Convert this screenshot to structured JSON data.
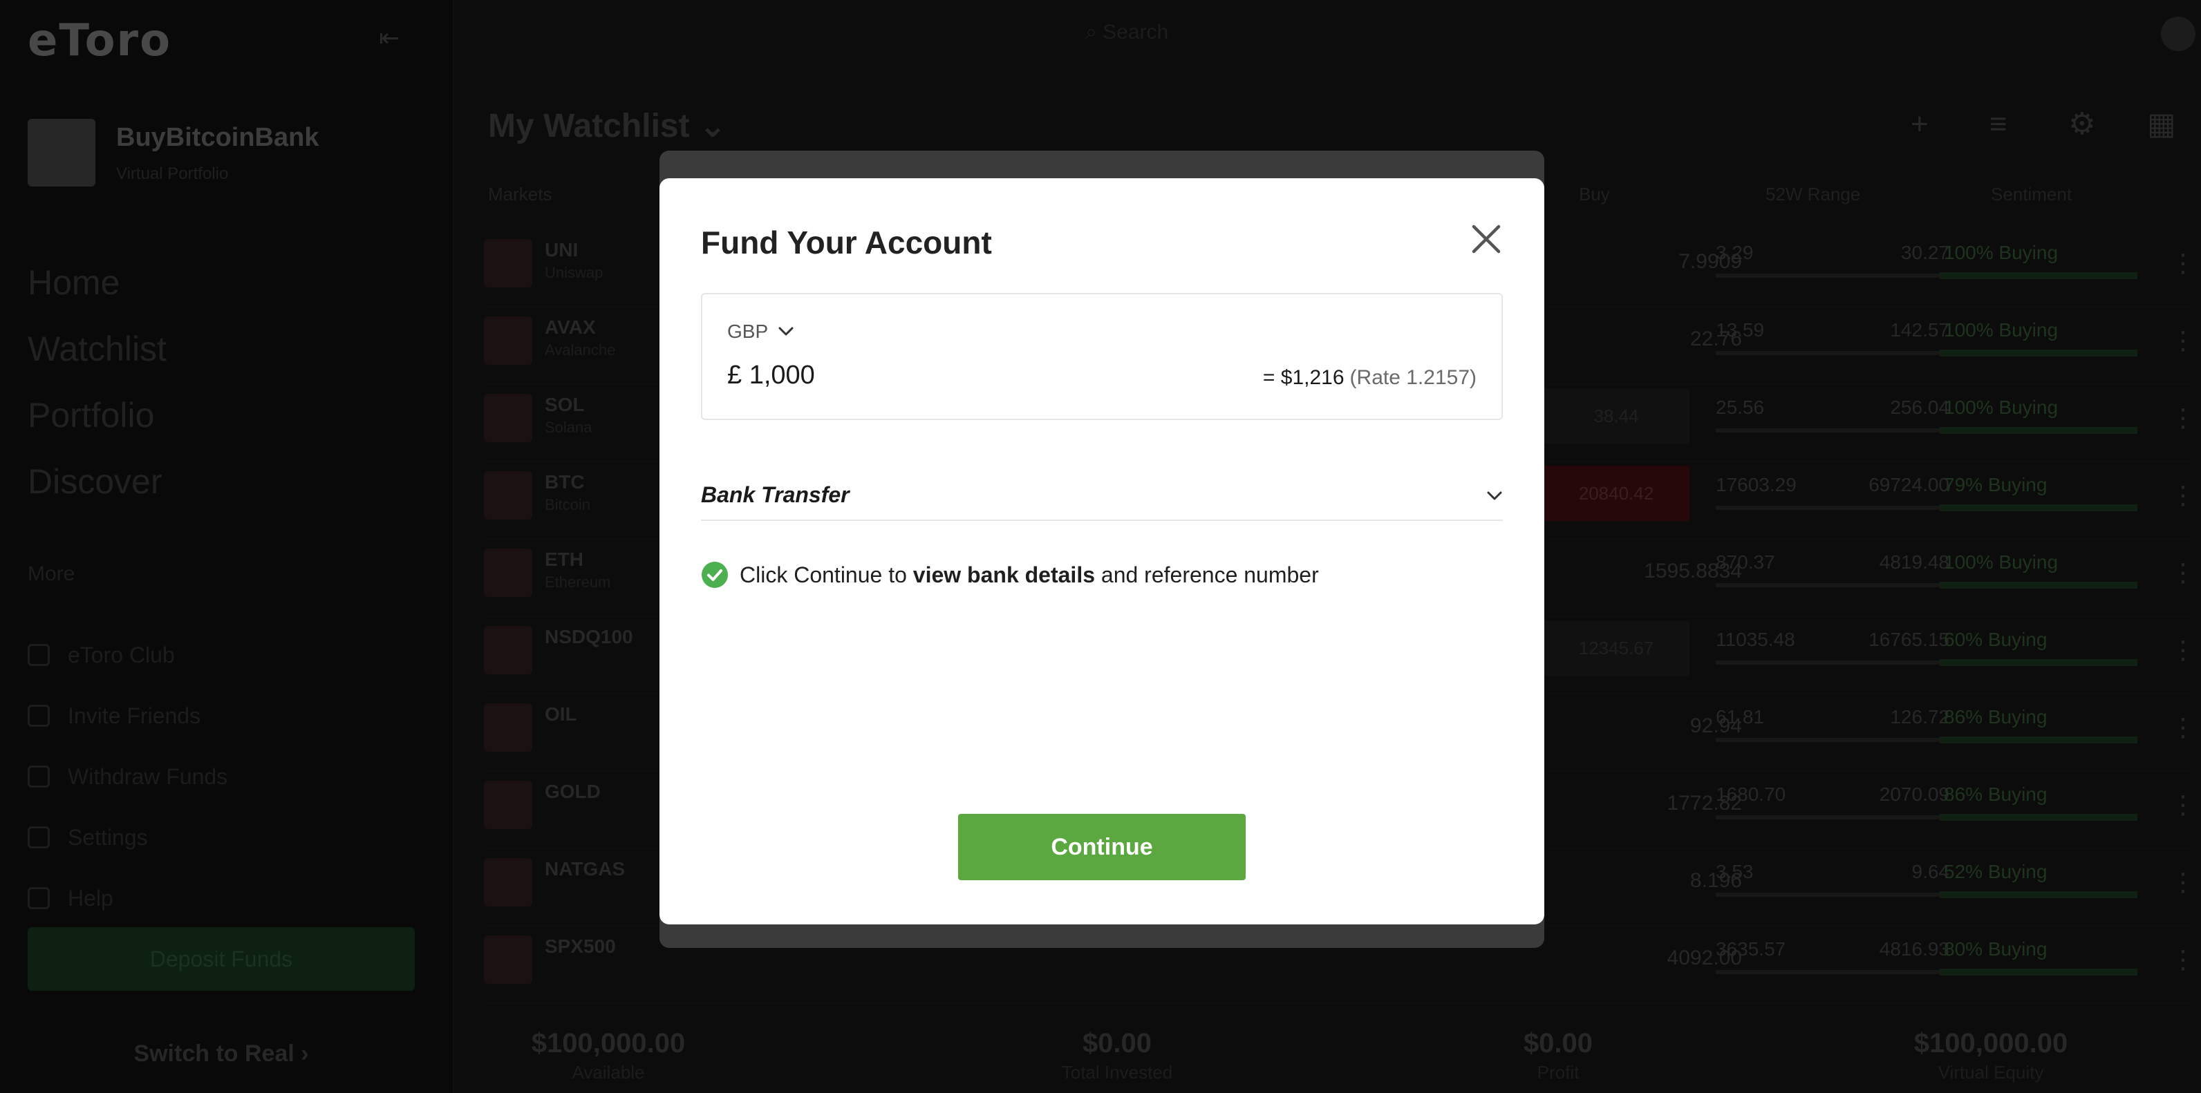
{
  "app": {
    "logo": "eToro"
  },
  "profile": {
    "name": "BuyBitcoinBank",
    "subtitle": "Virtual Portfolio"
  },
  "sidebar": {
    "main_items": [
      {
        "label": "Home"
      },
      {
        "label": "Watchlist"
      },
      {
        "label": "Portfolio"
      },
      {
        "label": "Discover"
      }
    ],
    "more_title": "More",
    "sub_items": [
      {
        "label": "eToro Club"
      },
      {
        "label": "Invite Friends"
      },
      {
        "label": "Withdraw Funds"
      },
      {
        "label": "Settings"
      },
      {
        "label": "Help"
      }
    ],
    "deposit_label": "Deposit Funds",
    "switch_label": "Switch to Real ›"
  },
  "topbar": {
    "search_placeholder": "Search"
  },
  "watchlist": {
    "title": "My Watchlist",
    "columns": {
      "markets": "Markets",
      "buy": "Buy",
      "range": "52W Range",
      "sentiment": "Sentiment"
    },
    "rows": [
      {
        "symbol": "UNI",
        "name": "Uniswap",
        "price": "7.9909",
        "low": "3.29",
        "high": "30.27",
        "sentiment": "100%",
        "sentiment_word": "Buying"
      },
      {
        "symbol": "AVAX",
        "name": "Avalanche",
        "price": "22.76",
        "low": "13.59",
        "high": "142.57",
        "sentiment": "100%",
        "sentiment_word": "Buying"
      },
      {
        "symbol": "SOL",
        "name": "Solana",
        "price": "38.44",
        "low": "25.56",
        "high": "256.04",
        "sentiment": "100%",
        "sentiment_word": "Buying"
      },
      {
        "symbol": "BTC",
        "name": "Bitcoin",
        "price": "20840.42",
        "low": "17603.29",
        "high": "69724.00",
        "sentiment": "79%",
        "sentiment_word": "Buying"
      },
      {
        "symbol": "ETH",
        "name": "Ethereum",
        "price": "1595.8834",
        "low": "870.37",
        "high": "4819.48",
        "sentiment": "100%",
        "sentiment_word": "Buying"
      },
      {
        "symbol": "NSDQ100",
        "name": "",
        "price": "12345.67",
        "low": "11035.48",
        "high": "16765.15",
        "sentiment": "60%",
        "sentiment_word": "Buying"
      },
      {
        "symbol": "OIL",
        "name": "",
        "price": "92.94",
        "low": "61.81",
        "high": "126.72",
        "sentiment": "86%",
        "sentiment_word": "Buying"
      },
      {
        "symbol": "GOLD",
        "name": "",
        "price": "1772.82",
        "low": "1680.70",
        "high": "2070.09",
        "sentiment": "86%",
        "sentiment_word": "Buying"
      },
      {
        "symbol": "NATGAS",
        "name": "",
        "price": "8.196",
        "low": "3.53",
        "high": "9.64",
        "sentiment": "52%",
        "sentiment_word": "Buying"
      },
      {
        "symbol": "SPX500",
        "name": "",
        "price": "4092.00",
        "low": "3635.57",
        "high": "4816.93",
        "sentiment": "80%",
        "sentiment_word": "Buying"
      }
    ]
  },
  "footer": {
    "available": {
      "value": "$100,000.00",
      "label": "Available"
    },
    "invested": {
      "value": "$0.00",
      "label": "Total Invested"
    },
    "profit": {
      "value": "$0.00",
      "label": "Profit"
    },
    "equity": {
      "value": "$100,000.00",
      "label": "Virtual Equity"
    }
  },
  "modal": {
    "title": "Fund Your Account",
    "currency": "GBP",
    "amount": "£ 1,000",
    "conversion": "= $1,216",
    "rate": "(Rate 1.2157)",
    "method": "Bank Transfer",
    "info_prefix": "Click Continue to ",
    "info_bold": "view bank details",
    "info_suffix": " and reference number",
    "continue_label": "Continue",
    "colors": {
      "accent": "#5aa83f",
      "check": "#4caf50"
    }
  }
}
